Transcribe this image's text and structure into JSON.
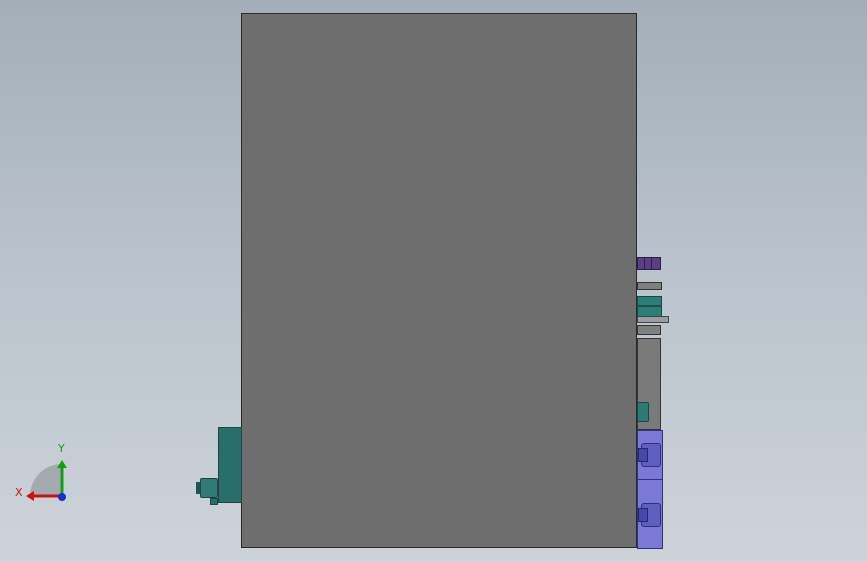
{
  "viewport": {
    "background_top": "#a3aeb9",
    "background_bottom": "#cdd3d9"
  },
  "model": {
    "main_body_color": "#6e6e6e",
    "accent_green": "#2a6e6a",
    "accent_purple": "#5a3f82",
    "accent_blue": "#7a7ad6"
  },
  "triad": {
    "x_label": "X",
    "y_label": "Y",
    "x_color": "#d01010",
    "y_color": "#10a010",
    "z_color": "#1030d0"
  }
}
